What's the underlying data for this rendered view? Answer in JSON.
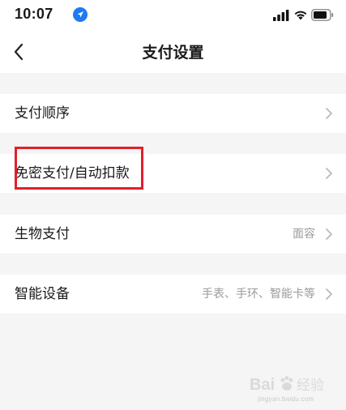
{
  "status_bar": {
    "time": "10:07"
  },
  "nav": {
    "title": "支付设置"
  },
  "settings": {
    "rows": [
      {
        "label": "支付顺序",
        "value": ""
      },
      {
        "label": "免密支付/自动扣款",
        "value": ""
      },
      {
        "label": "生物支付",
        "value": "面容"
      },
      {
        "label": "智能设备",
        "value": "手表、手环、智能卡等"
      }
    ]
  },
  "watermark": {
    "logo_text": "Bai",
    "logo_text_cn": "经验",
    "sub": "jingyan.baidu.com"
  },
  "colors": {
    "highlight": "#e0202a",
    "background": "#f5f5f5",
    "row_background": "#ffffff",
    "secondary_text": "#9a9a9a"
  },
  "icons": {
    "status": [
      "location-arrow-icon",
      "cellular-signal-icon",
      "wifi-icon",
      "battery-icon"
    ],
    "row_action": "chevron-right-icon",
    "nav_back": "chevron-left-icon"
  }
}
